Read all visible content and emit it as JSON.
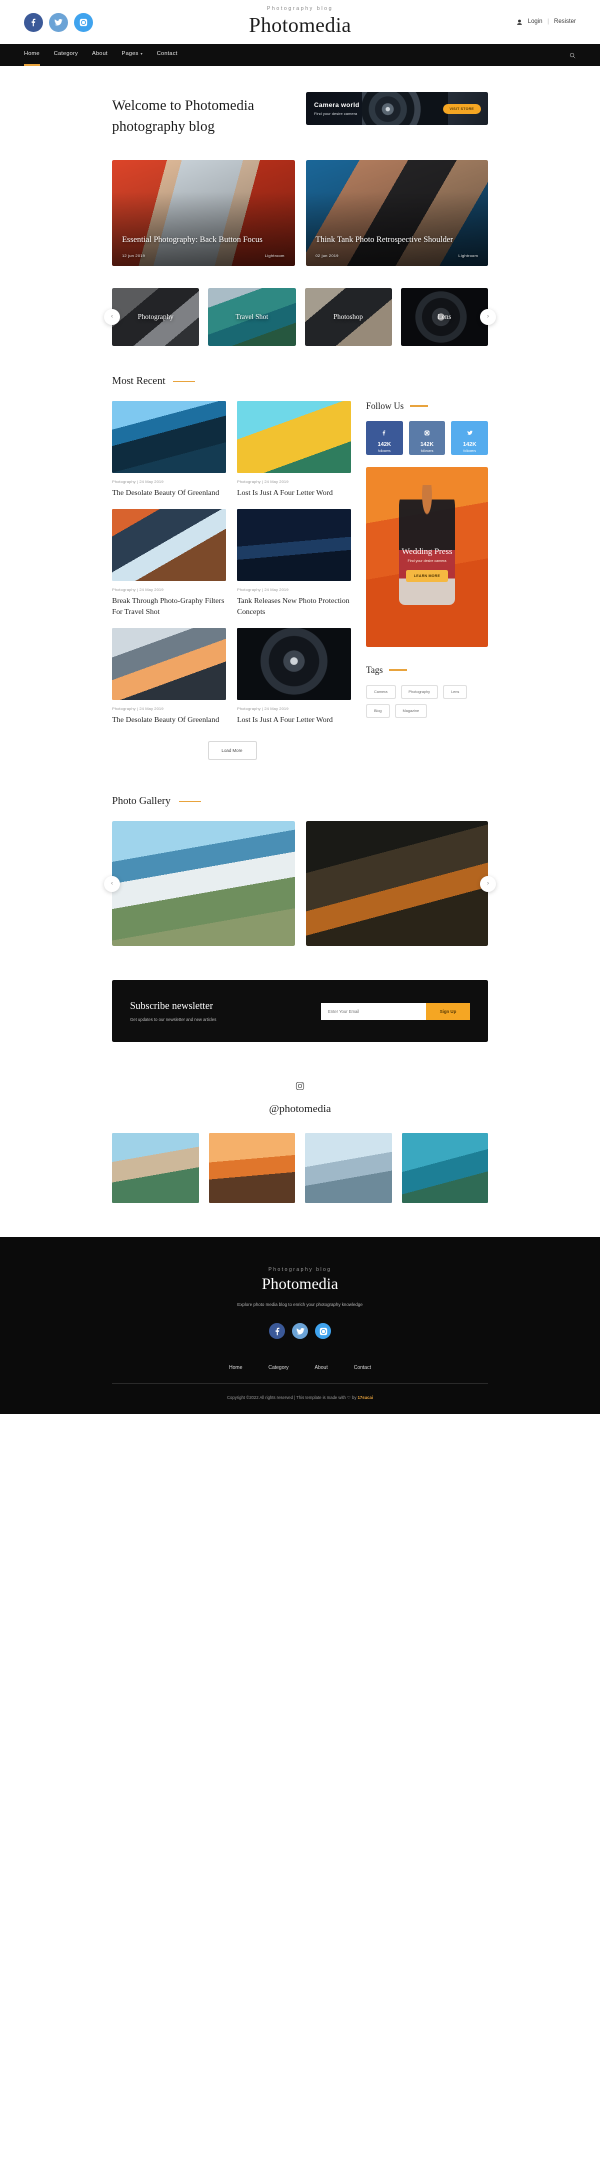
{
  "header": {
    "kicker": "Photography blog",
    "brand": "Photomedia",
    "social": [
      {
        "name": "facebook",
        "glyph": "f"
      },
      {
        "name": "twitter",
        "glyph": "t"
      },
      {
        "name": "instagram",
        "glyph": "i"
      }
    ],
    "login": "Login",
    "separator": "|",
    "register": "Resister"
  },
  "nav": {
    "items": [
      {
        "label": "Home",
        "active": true,
        "caret": false
      },
      {
        "label": "Category",
        "active": false,
        "caret": false
      },
      {
        "label": "About",
        "active": false,
        "caret": false
      },
      {
        "label": "Pages",
        "active": false,
        "caret": true
      },
      {
        "label": "Contact",
        "active": false,
        "caret": false
      }
    ],
    "search_icon": "search-icon"
  },
  "hero": {
    "title_line1": "Welcome to Photomedia",
    "title_line2": "photography blog",
    "ad": {
      "title": "Camera world",
      "subtitle": "Find your desire camera",
      "button": "VISIT STORE"
    }
  },
  "featured": [
    {
      "title": "Essential Photography: Back Button Focus",
      "date": "12 jun 2019",
      "category": "Lightroom"
    },
    {
      "title": "Think Tank Photo Retrospective Shoulder",
      "date": "02 jun 2019",
      "category": "Lightroom"
    }
  ],
  "categories": {
    "prev": "‹",
    "next": "›",
    "items": [
      {
        "label": "Photography"
      },
      {
        "label": "Travel Shot"
      },
      {
        "label": "Photoshop"
      },
      {
        "label": "Lens"
      }
    ]
  },
  "most_recent": {
    "heading": "Most Recent",
    "posts": [
      {
        "meta": "Photography | 24 May 2019",
        "title": "The Desolate Beauty Of Greenland"
      },
      {
        "meta": "Photography | 24 May 2019",
        "title": "Lost Is Just A Four Letter Word"
      },
      {
        "meta": "Photography | 24 May 2019",
        "title": "Break Through Photo-Graphy Filters For Travel Shot"
      },
      {
        "meta": "Photography | 24 May 2019",
        "title": "Tank Releases New Photo Protection Concepts"
      },
      {
        "meta": "Photography | 24 May 2019",
        "title": "The Desolate Beauty Of Greenland"
      },
      {
        "meta": "Photography | 24 May 2019",
        "title": "Lost Is Just A Four Letter Word"
      }
    ],
    "load_more": "Load More"
  },
  "sidebar": {
    "follow": {
      "heading": "Follow Us",
      "items": [
        {
          "network": "facebook",
          "count": "142K",
          "label": "followers"
        },
        {
          "network": "instagram",
          "count": "142K",
          "label": "followers"
        },
        {
          "network": "twitter",
          "count": "142K",
          "label": "followers"
        }
      ]
    },
    "promo": {
      "title": "Wedding Press",
      "subtitle": "Find your desire camera",
      "button": "LEARN MORE"
    },
    "tags": {
      "heading": "Tags",
      "items": [
        "Camera",
        "Photography",
        "Lens",
        "Blog",
        "Magazine"
      ]
    }
  },
  "gallery": {
    "heading": "Photo Gallery",
    "prev": "‹",
    "next": "›"
  },
  "newsletter": {
    "title": "Subscribe newsletter",
    "subtitle": "Get updates to our newsletter and new articles",
    "placeholder": "Enter Your Email",
    "button": "Sign Up"
  },
  "instagram": {
    "icon": "instagram-icon",
    "handle": "@photomedia"
  },
  "footer": {
    "kicker": "Photography blog",
    "brand": "Photomedia",
    "description": "Explore photo media blog to enrich your photography knowledge",
    "social": [
      {
        "name": "facebook",
        "glyph": "f"
      },
      {
        "name": "twitter",
        "glyph": "t"
      },
      {
        "name": "instagram",
        "glyph": "i"
      }
    ],
    "nav": [
      "Home",
      "Category",
      "About",
      "Contact"
    ],
    "copyright_prefix": "Copyright ©2022 All rights reserved | This template is made with",
    "heart": "♡",
    "copyright_by": "by",
    "credit": "17sucai"
  },
  "colors": {
    "accent": "#e8a33d",
    "cta": "#f5a623",
    "dark": "#0e0e0e",
    "facebook": "#3b5998",
    "twitter": "#55acee",
    "instagram": "#3fa3ee"
  }
}
